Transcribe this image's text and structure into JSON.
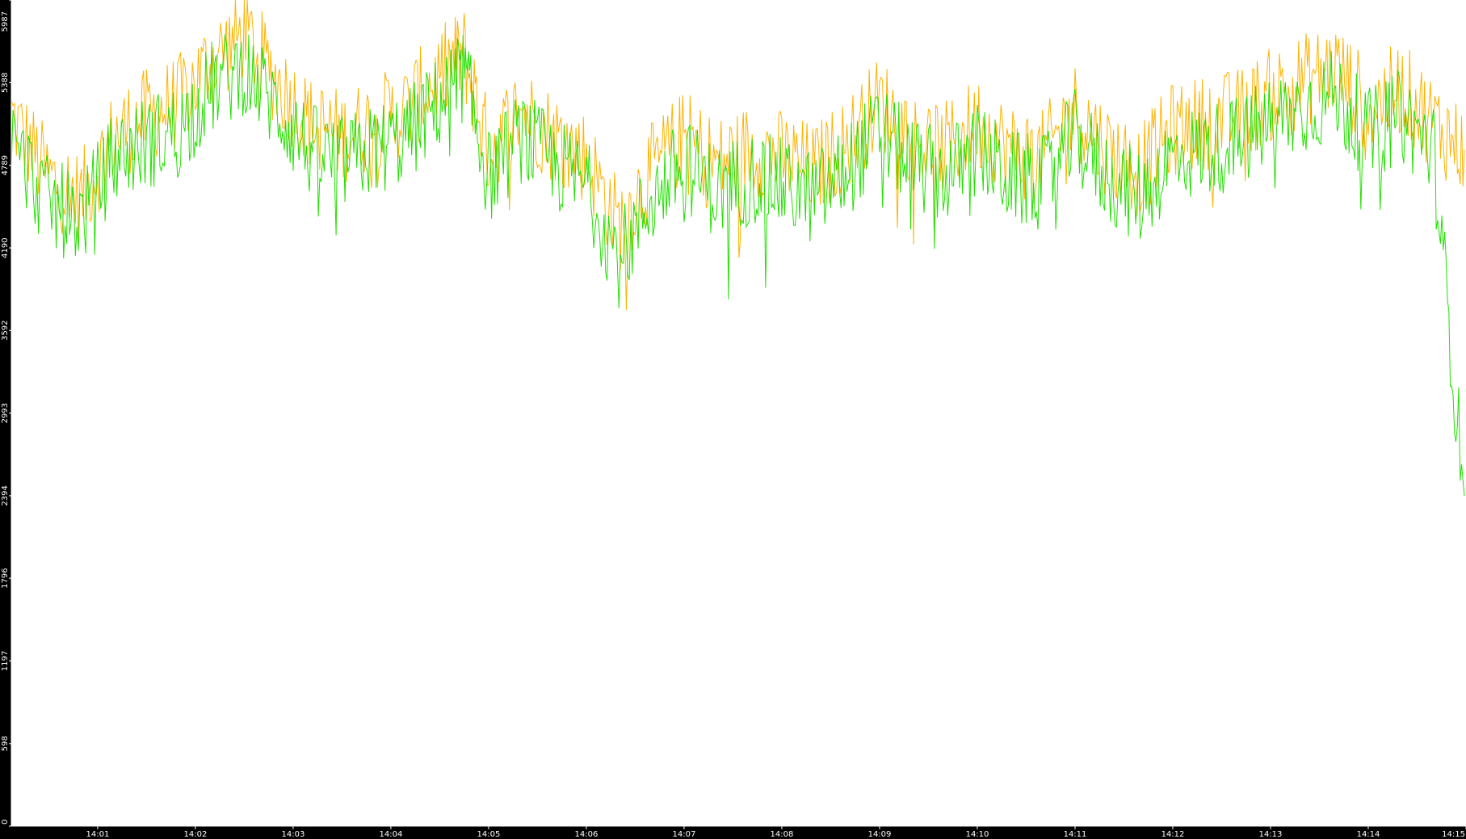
{
  "colors": {
    "background": "#000000",
    "plot_background": "#ffffff",
    "axis": "#ffffff",
    "series_upper": "#ffb300",
    "series_lower": "#22e000"
  },
  "chart_data": {
    "type": "line",
    "title": "",
    "xlabel": "",
    "ylabel": "",
    "grid": false,
    "legend": "none",
    "xlim": [
      "14:00:07",
      "14:15:00"
    ],
    "ylim": [
      0,
      5987
    ],
    "x_tick_labels": [
      "14:01",
      "14:02",
      "14:03",
      "14:04",
      "14:05",
      "14:06",
      "14:07",
      "14:08",
      "14:09",
      "14:10",
      "14:11",
      "14:12",
      "14:13",
      "14:14",
      "14:15"
    ],
    "y_tick_labels": [
      "0",
      "598",
      "1197",
      "1796",
      "2394",
      "2993",
      "3592",
      "4190",
      "4789",
      "5388",
      "5987"
    ],
    "x": [
      "14:00:07",
      "14:00:30",
      "14:00:50",
      "14:01:10",
      "14:01:30",
      "14:01:50",
      "14:02:10",
      "14:02:30",
      "14:02:50",
      "14:03:10",
      "14:03:30",
      "14:03:50",
      "14:04:10",
      "14:04:30",
      "14:04:45",
      "14:05:00",
      "14:05:20",
      "14:05:40",
      "14:06:00",
      "14:06:20",
      "14:06:40",
      "14:07:00",
      "14:07:20",
      "14:07:40",
      "14:08:00",
      "14:08:20",
      "14:08:40",
      "14:09:00",
      "14:09:20",
      "14:09:40",
      "14:10:00",
      "14:10:20",
      "14:10:40",
      "14:11:00",
      "14:11:20",
      "14:11:40",
      "14:12:00",
      "14:12:20",
      "14:12:40",
      "14:13:00",
      "14:13:20",
      "14:13:40",
      "14:14:00",
      "14:14:20",
      "14:14:40",
      "14:14:59"
    ],
    "series": [
      {
        "color": "#ffb300",
        "values": [
          5150,
          4700,
          4550,
          5000,
          5150,
          5250,
          5550,
          5750,
          5400,
          5100,
          5000,
          5100,
          5200,
          5450,
          5600,
          4900,
          5200,
          5000,
          4850,
          4350,
          4750,
          5000,
          4800,
          4900,
          4850,
          4750,
          4950,
          5250,
          5000,
          4900,
          5100,
          4900,
          4850,
          5200,
          4900,
          4750,
          5050,
          5100,
          5150,
          5300,
          5400,
          5500,
          5200,
          5350,
          5100,
          4900
        ]
      },
      {
        "color": "#22e000",
        "values": [
          4950,
          4500,
          4400,
          4850,
          4950,
          5050,
          5350,
          5500,
          5200,
          4900,
          4800,
          4900,
          5000,
          5250,
          5450,
          4700,
          5000,
          4800,
          4650,
          4100,
          4550,
          4800,
          4600,
          4700,
          4650,
          4550,
          4750,
          5050,
          4800,
          4700,
          4900,
          4700,
          4650,
          5000,
          4700,
          4550,
          4850,
          4900,
          4950,
          5100,
          5200,
          5300,
          5000,
          5150,
          4900,
          2394
        ]
      }
    ]
  }
}
